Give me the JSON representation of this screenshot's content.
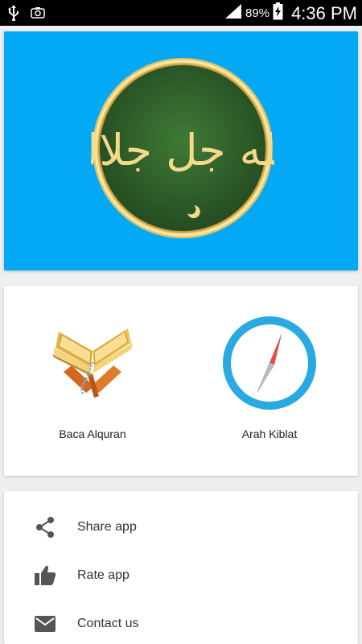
{
  "status_bar": {
    "battery_percent": "89%",
    "time": "4:36 PM",
    "icons": [
      "usb-icon",
      "screenshot-icon",
      "signal-icon",
      "battery-charging-icon"
    ]
  },
  "banner": {
    "emblem_text": "الله جل جلاله",
    "colors": {
      "background": "#03a9f4",
      "emblem_green": "#2e5e2b",
      "emblem_gold": "#f7d98a"
    }
  },
  "features": [
    {
      "label": "Baca Alquran",
      "icon": "quran-book-icon"
    },
    {
      "label": "Arah Kiblat",
      "icon": "compass-icon"
    }
  ],
  "menu": [
    {
      "label": "Share app",
      "icon": "share-icon"
    },
    {
      "label": "Rate app",
      "icon": "thumbs-up-icon"
    },
    {
      "label": "Contact us",
      "icon": "mail-icon"
    }
  ]
}
